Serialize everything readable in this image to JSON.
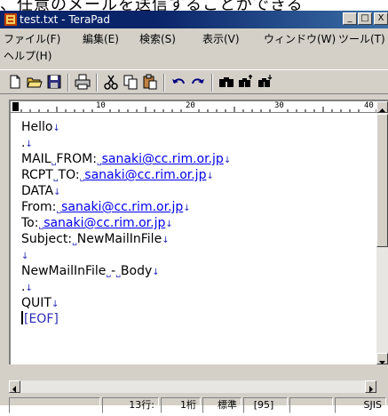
{
  "top_strip_text": "、任意のメールを送信することができる",
  "window": {
    "title": "test.txt - TeraPad",
    "controls": {
      "minimize": "_",
      "maximize": "□",
      "close": "X"
    }
  },
  "menu": [
    "ファイル(F)",
    "編集(E)",
    "検索(S)",
    "表示(V)",
    "ウィンドウ(W)",
    "ツール(T)",
    "ヘルプ(H)"
  ],
  "toolbar": {
    "icons": [
      "new-file-icon",
      "open-folder-icon",
      "save-icon",
      "print-icon",
      "cut-icon",
      "copy-icon",
      "paste-icon",
      "undo-icon",
      "redo-icon",
      "find-icon",
      "find-next-icon",
      "find-prev-icon"
    ]
  },
  "ruler": {
    "marks": [
      "10",
      "20",
      "30",
      "40"
    ]
  },
  "editor": {
    "lines": [
      {
        "parts": [
          {
            "t": "Hello"
          }
        ],
        "end": "↓"
      },
      {
        "parts": [
          {
            "t": "."
          }
        ],
        "end": "↓"
      },
      {
        "parts": [
          {
            "t": "MAIL"
          },
          {
            "b": "␣"
          },
          {
            "t": "FROM:"
          },
          {
            "b": "␣"
          },
          {
            "l": "sanaki@cc.rim.or.jp"
          }
        ],
        "end": "↓"
      },
      {
        "parts": [
          {
            "t": "RCPT"
          },
          {
            "b": "␣"
          },
          {
            "t": "TO:"
          },
          {
            "b": "␣"
          },
          {
            "l": "sanaki@cc.rim.or.jp"
          }
        ],
        "end": "↓"
      },
      {
        "parts": [
          {
            "t": "DATA"
          }
        ],
        "end": "↓"
      },
      {
        "parts": [
          {
            "t": "From:"
          },
          {
            "b": "␣"
          },
          {
            "l": "sanaki@cc.rim.or.jp"
          }
        ],
        "end": "↓"
      },
      {
        "parts": [
          {
            "t": "To:"
          },
          {
            "b": "␣"
          },
          {
            "l": "sanaki@cc.rim.or.jp"
          }
        ],
        "end": "↓"
      },
      {
        "parts": [
          {
            "t": "Subject:"
          },
          {
            "b": "␣"
          },
          {
            "t": "NewMailInFile"
          }
        ],
        "end": "↓"
      },
      {
        "parts": [],
        "end": "↓"
      },
      {
        "parts": [
          {
            "t": "NewMailInFile"
          },
          {
            "b": "␣"
          },
          {
            "t": "-"
          },
          {
            "b": "␣"
          },
          {
            "t": "Body"
          }
        ],
        "end": "↓"
      },
      {
        "parts": [
          {
            "t": "."
          }
        ],
        "end": "↓"
      },
      {
        "parts": [
          {
            "t": "QUIT"
          }
        ],
        "end": "↓"
      }
    ],
    "eof": "[EOF]"
  },
  "status": {
    "line": "13行:",
    "col": "1桁",
    "mode": "標準",
    "code": "[95]",
    "blank": "",
    "encoding": "SJIS"
  }
}
